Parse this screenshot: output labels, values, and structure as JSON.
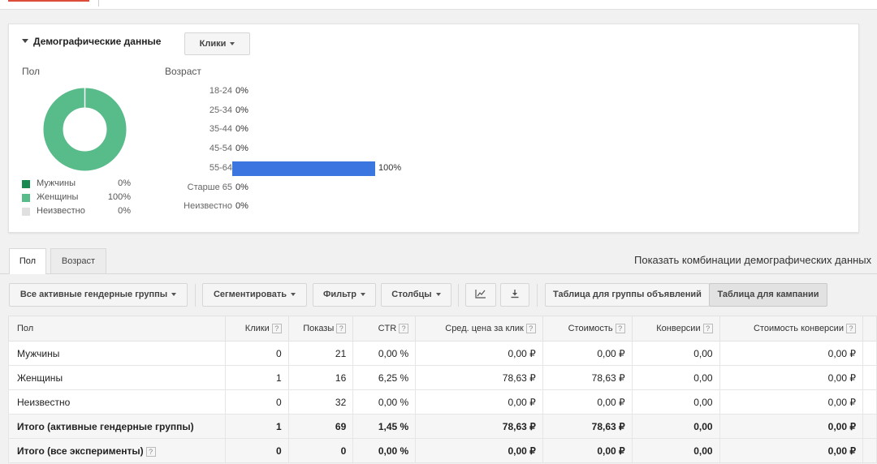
{
  "demographics": {
    "title": "Демографические данные",
    "metric_button": "Клики",
    "gender": {
      "label": "Пол",
      "segments": [
        {
          "name": "Мужчины",
          "value": "0%",
          "color": "#168a4f",
          "fraction": 0
        },
        {
          "name": "Женщины",
          "value": "100%",
          "color": "#57bb8a",
          "fraction": 1
        },
        {
          "name": "Неизвестно",
          "value": "0%",
          "color": "#e0e0e0",
          "fraction": 0
        }
      ]
    },
    "age": {
      "label": "Возраст",
      "rows": [
        {
          "range": "18-24",
          "value": "0%",
          "fraction": 0
        },
        {
          "range": "25-34",
          "value": "0%",
          "fraction": 0
        },
        {
          "range": "35-44",
          "value": "0%",
          "fraction": 0
        },
        {
          "range": "45-54",
          "value": "0%",
          "fraction": 0
        },
        {
          "range": "55-64",
          "value": "100%",
          "fraction": 1
        },
        {
          "range": "Старше 65",
          "value": "0%",
          "fraction": 0
        },
        {
          "range": "Неизвестно",
          "value": "0%",
          "fraction": 0
        }
      ],
      "bar_color": "#3a75e0"
    }
  },
  "tabs": {
    "gender": "Пол",
    "age": "Возраст",
    "combinations_link": "Показать комбинации демографических данных"
  },
  "toolbar": {
    "gender_groups": "Все активные гендерные группы",
    "segment": "Сегментировать",
    "filter": "Фильтр",
    "columns": "Столбцы",
    "chart_icon": "line-chart-icon",
    "download_icon": "download-icon",
    "adgroup_table": "Таблица для группы объявлений",
    "campaign_table": "Таблица для кампании"
  },
  "table": {
    "headers": [
      "Пол",
      "Клики",
      "Показы",
      "CTR",
      "Сред. цена за клик",
      "Стоимость",
      "Конверсии",
      "Стоимость конверсии"
    ],
    "rows": [
      [
        "Мужчины",
        "0",
        "21",
        "0,00 %",
        "0,00 ₽",
        "0,00 ₽",
        "0,00",
        "0,00 ₽"
      ],
      [
        "Женщины",
        "1",
        "16",
        "6,25 %",
        "78,63 ₽",
        "78,63 ₽",
        "0,00",
        "0,00 ₽"
      ],
      [
        "Неизвестно",
        "0",
        "32",
        "0,00 %",
        "0,00 ₽",
        "0,00 ₽",
        "0,00",
        "0,00 ₽"
      ]
    ],
    "totals": [
      [
        "Итого (активные гендерные группы)",
        "1",
        "69",
        "1,45 %",
        "78,63 ₽",
        "78,63 ₽",
        "0,00",
        "0,00 ₽"
      ],
      [
        "Итого (все эксперименты)",
        "0",
        "0",
        "0,00 %",
        "0,00 ₽",
        "0,00 ₽",
        "0,00",
        "0,00 ₽"
      ]
    ]
  },
  "help_mark": "?"
}
